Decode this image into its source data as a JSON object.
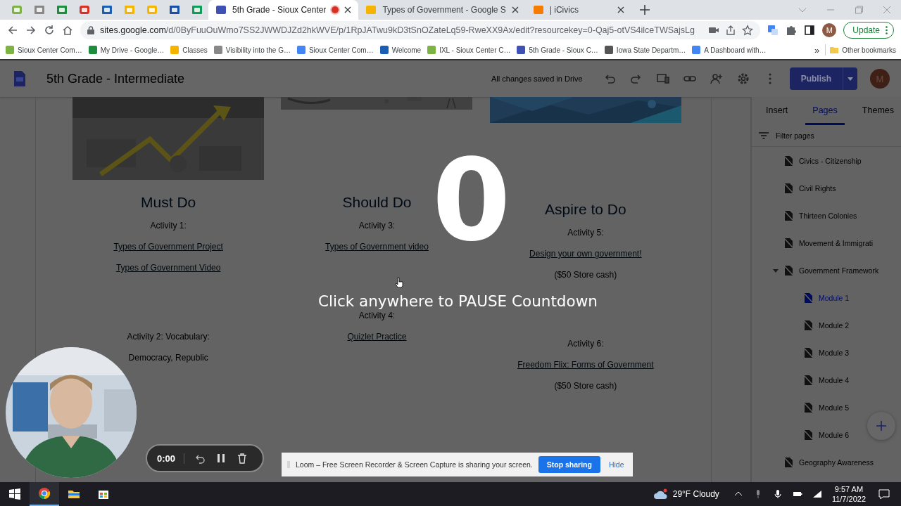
{
  "browser": {
    "tabs": [
      {
        "title": "5th Grade - Sioux Center",
        "selected": true,
        "recording": true
      },
      {
        "title": "Types of Government - Google S",
        "selected": false,
        "recording": false
      },
      {
        "title": "| iCivics",
        "selected": false,
        "recording": false
      }
    ],
    "url_host": "sites.google.com",
    "url_path": "/d/0ByFuuOuWmo7SS2JWWDJZd2hkWVE/p/1RpJATwu9kD3tSnOZateLq59-RweXX9Ax/edit?resourcekey=0-Qaj5-otVS4ilceTWSajsLg",
    "profile": "M",
    "update": "Update",
    "bookmarks": [
      "Sioux Center Com…",
      "My Drive - Google…",
      "Classes",
      "Visibility into the G…",
      "Sioux Center Com…",
      "Welcome",
      "IXL - Sioux Center C…",
      "5th Grade - Sioux C…",
      "Iowa State Departm…",
      "A Dashboard with…"
    ],
    "more_bookmarks": "»",
    "other_bookmarks": "Other bookmarks"
  },
  "site": {
    "title": "5th Grade - Intermediate",
    "status": "All changes saved in Drive",
    "publish": "Publish",
    "avatar": "M",
    "columns": [
      {
        "heading": "Must Do",
        "groups": [
          [
            {
              "kind": "text",
              "text": "Activity 1:"
            },
            {
              "kind": "link",
              "text": "Types of Government Project"
            },
            {
              "kind": "link",
              "text": "Types of Government Video"
            }
          ],
          [
            {
              "kind": "text",
              "text": "Activity 2: Vocabulary:"
            },
            {
              "kind": "text",
              "text": "Democracy, Republic"
            }
          ]
        ]
      },
      {
        "heading": "Should Do",
        "groups": [
          [
            {
              "kind": "text",
              "text": "Activity 3:"
            },
            {
              "kind": "link",
              "text": "Types of Government video"
            }
          ],
          [
            {
              "kind": "text",
              "text": "Activity 4:"
            },
            {
              "kind": "link",
              "text": "Quizlet Practice"
            }
          ]
        ]
      },
      {
        "heading": "Aspire to Do",
        "groups": [
          [
            {
              "kind": "text",
              "text": "Activity 5:"
            },
            {
              "kind": "link",
              "text": "Design your own government!"
            },
            {
              "kind": "text",
              "text": "($50 Store cash)"
            }
          ],
          [
            {
              "kind": "text",
              "text": "Activity 6:"
            },
            {
              "kind": "link",
              "text": "Freedom Flix: Forms of Government"
            },
            {
              "kind": "text",
              "text": "($50 Store cash)"
            }
          ]
        ]
      }
    ],
    "panel": {
      "tabs": [
        {
          "label": "Insert",
          "selected": false
        },
        {
          "label": "Pages",
          "selected": true
        },
        {
          "label": "Themes",
          "selected": false
        }
      ],
      "filter": {
        "placeholder": "Filter pages"
      },
      "pages": [
        {
          "label": "Civics - Citizenship",
          "selected": false
        },
        {
          "label": "Civil Rights",
          "selected": false
        },
        {
          "label": "Thirteen Colonies",
          "selected": false
        },
        {
          "label": "Movement & Immigrati",
          "selected": false
        },
        {
          "label": "Government Framework",
          "selected": false,
          "expanded": true,
          "children": [
            {
              "label": "Module 1",
              "selected": true
            },
            {
              "label": "Module 2",
              "selected": false
            },
            {
              "label": "Module 3",
              "selected": false
            },
            {
              "label": "Module 4",
              "selected": false
            },
            {
              "label": "Module 5",
              "selected": false
            },
            {
              "label": "Module 6",
              "selected": false
            }
          ]
        },
        {
          "label": "Geography Awareness",
          "selected": false
        }
      ]
    }
  },
  "countdown": {
    "number": "0",
    "message": "Click anywhere to PAUSE Countdown"
  },
  "recorder": {
    "time": "0:00"
  },
  "loom": {
    "message": "Loom – Free Screen Recorder & Screen Capture is sharing your screen.",
    "stop": "Stop sharing",
    "hide": "Hide"
  },
  "taskbar": {
    "weather": "29°F Cloudy",
    "time": "9:57 AM",
    "date": "11/7/2022"
  }
}
